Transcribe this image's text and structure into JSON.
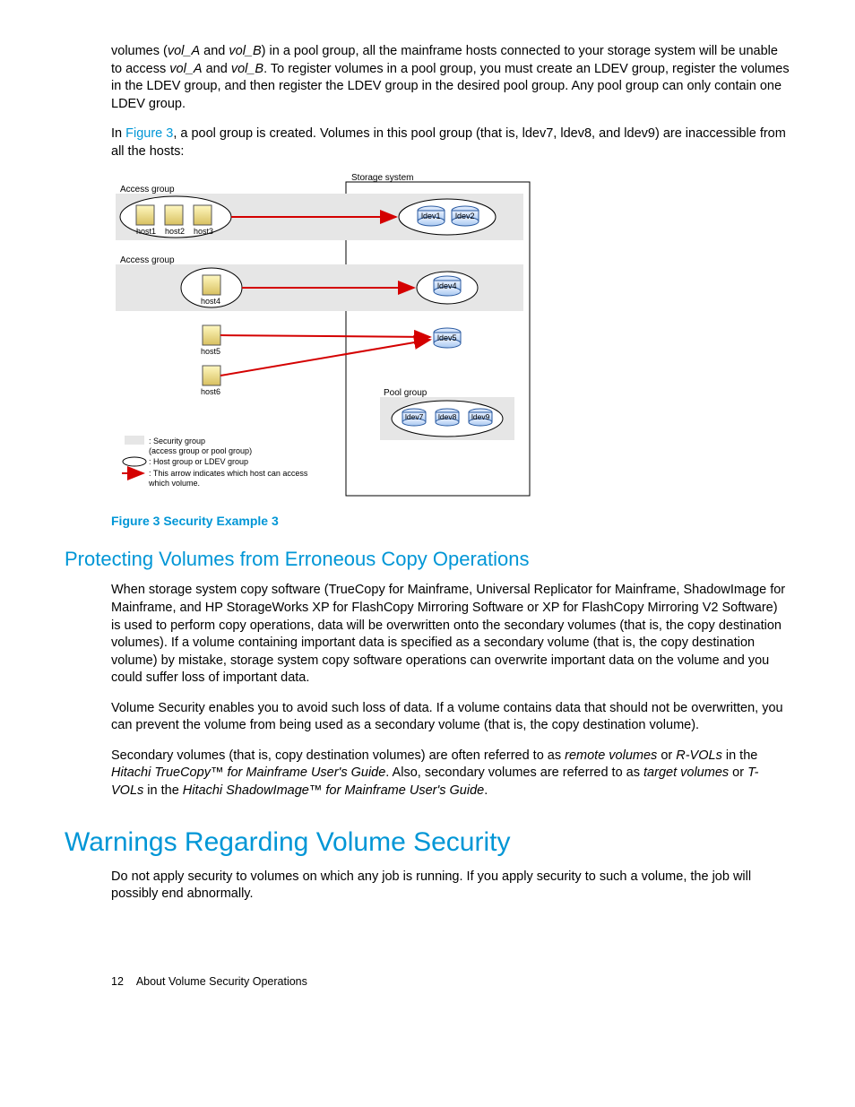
{
  "p1_a": "volumes (",
  "p1_b": " and ",
  "p1_c": ") in a pool group, all the mainframe hosts connected to your storage system will be unable to access ",
  "p1_d": " and ",
  "p1_e": ". To register volumes in a pool group, you must create an LDEV group, register the volumes in the LDEV group, and then register the LDEV group in the desired pool group. Any pool group can only contain one LDEV group.",
  "vol_a": "vol_A",
  "vol_b": "vol_B",
  "p2_a": "In ",
  "p2_link": "Figure 3",
  "p2_b": ", a pool group is created. Volumes in this pool group (that is, ldev7, ldev8, and ldev9) are inaccessible from all the hosts:",
  "fig": {
    "storage_system": "Storage system",
    "access_group": "Access group",
    "pool_group": "Pool group",
    "host1": "host1",
    "host2": "host2",
    "host3": "host3",
    "host4": "host4",
    "host5": "host5",
    "host6": "host6",
    "ldev1": "ldev1",
    "ldev2": "ldev2",
    "ldev4": "ldev4",
    "ldev5": "ldev5",
    "ldev7": "ldev7",
    "ldev8": "ldev8",
    "ldev9": "ldev9",
    "legend1": ": Security group",
    "legend1b": "  (access group or pool group)",
    "legend2": ": Host group or LDEV group",
    "legend3": ": This arrow indicates which host can access",
    "legend3b": "  which volume."
  },
  "figure_caption": "Figure 3 Security Example 3",
  "h2": "Protecting Volumes from Erroneous Copy Operations",
  "p3": "When storage system copy software (TrueCopy for Mainframe, Universal Replicator for Mainframe, ShadowImage for Mainframe, and HP StorageWorks XP for FlashCopy Mirroring Software or XP for FlashCopy Mirroring V2 Software) is used to perform copy operations, data will be overwritten onto the secondary volumes (that is, the copy destination volumes). If a volume containing important data is specified as a secondary volume (that is, the copy destination volume) by mistake, storage system copy software operations can overwrite important data on the volume and you could suffer loss of important data.",
  "p4": "Volume Security enables you to avoid such loss of data. If a volume contains data that should not be overwritten, you can prevent the volume from being used as a secondary volume (that is, the copy destination volume).",
  "p5_a": "Secondary volumes (that is, copy destination volumes) are often referred to as ",
  "p5_remote": "remote volumes",
  "p5_b": " or ",
  "p5_rvols": "R-VOLs",
  "p5_c": " in the ",
  "p5_guide1": "Hitachi TrueCopy™ for Mainframe User's Guide",
  "p5_d": ". Also, secondary volumes are referred to as ",
  "p5_target": "target volumes",
  "p5_e": " or ",
  "p5_tvols": "T-VOLs",
  "p5_f": " in the ",
  "p5_guide2": "Hitachi ShadowImage™ for Mainframe User's Guide",
  "p5_g": ".",
  "h1": "Warnings Regarding Volume Security",
  "p6": "Do not apply security to volumes on which any job is running. If you apply security to such a volume, the job will possibly end abnormally.",
  "footer_num": "12",
  "footer_text": "About Volume Security Operations"
}
